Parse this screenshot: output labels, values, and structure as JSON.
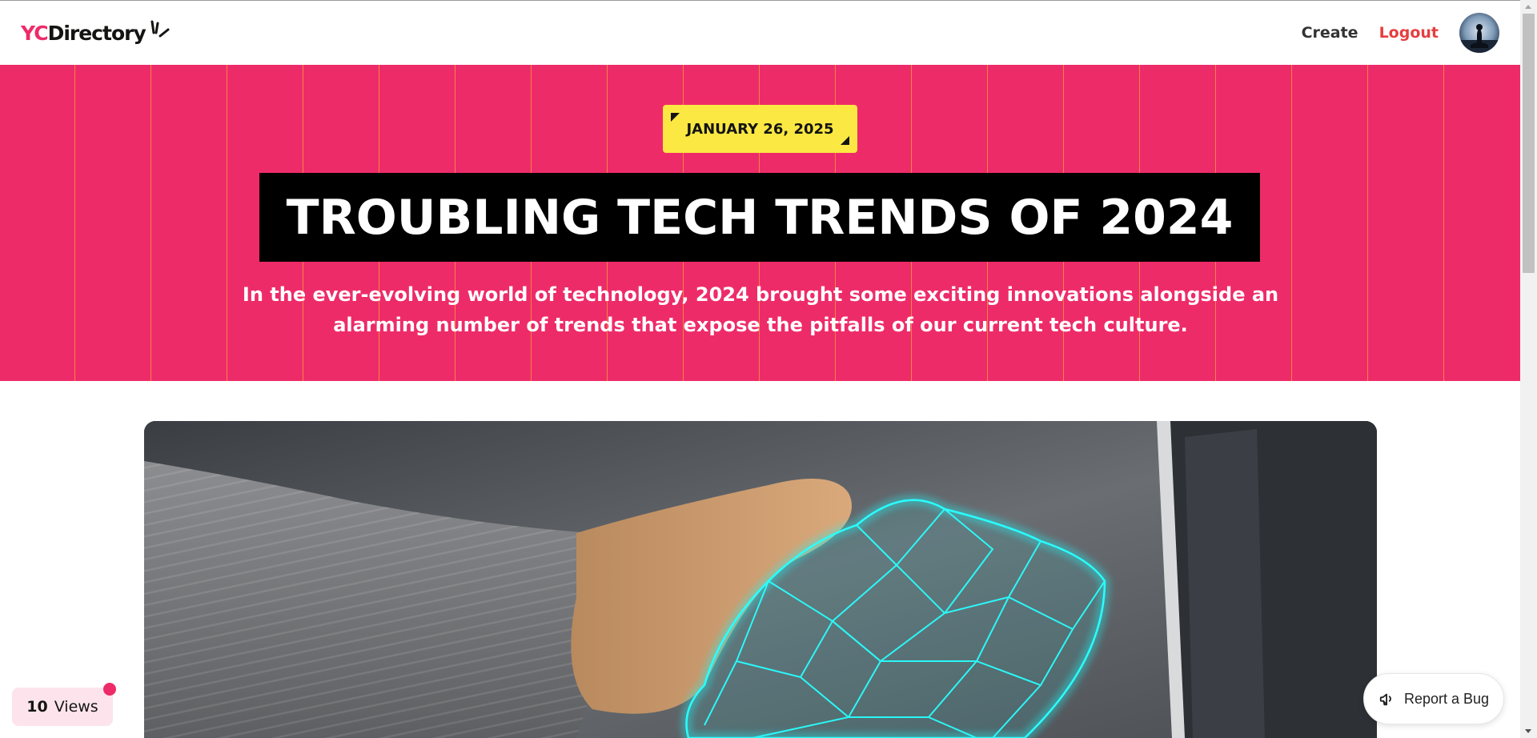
{
  "header": {
    "logo_prefix": "YC",
    "logo_suffix": "Directory",
    "nav": {
      "create_label": "Create",
      "logout_label": "Logout"
    }
  },
  "hero": {
    "date": "JANUARY 26, 2025",
    "title": "TROUBLING TECH TRENDS OF 2024",
    "subtitle": "In the ever-evolving world of technology, 2024 brought some exciting innovations alongside an alarming number of trends that expose the pitfalls of our current tech culture."
  },
  "views": {
    "count": "10",
    "label": "Views"
  },
  "report": {
    "label": "Report a Bug"
  },
  "colors": {
    "brand_pink": "#ee2b69",
    "tag_yellow": "#fbe843",
    "logout_red": "#e53e3e"
  },
  "icons": {
    "logo_mark": "sparkle-lines-icon",
    "report": "megaphone-icon"
  }
}
